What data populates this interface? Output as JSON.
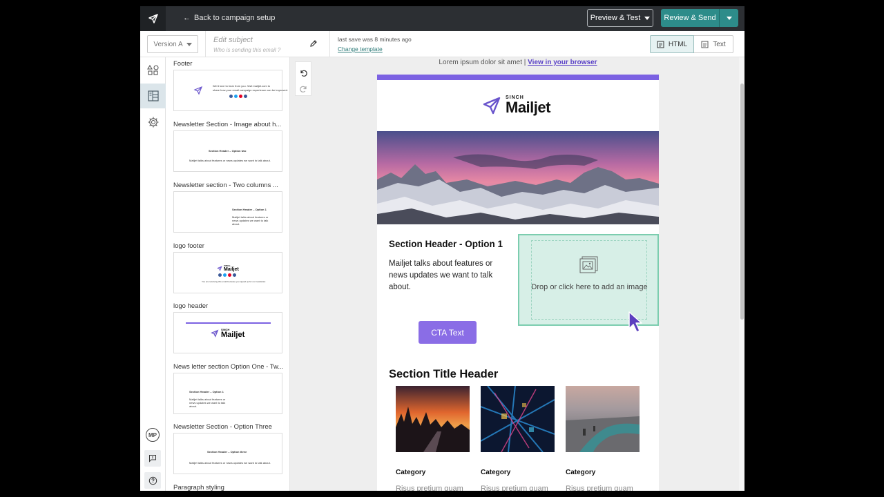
{
  "topbar": {
    "back_label": "Back to campaign setup",
    "preview_label": "Preview & Test",
    "review_label": "Review & Send"
  },
  "subbar": {
    "version": "Version A",
    "subject_placeholder": "Edit subject",
    "sender_placeholder": "Who is sending this email ?",
    "last_save": "last save was 8 minutes ago",
    "change_template": "Change template",
    "html_label": "HTML",
    "text_label": "Text"
  },
  "rail": {
    "user_initials": "MP"
  },
  "templates": [
    {
      "label": "Footer"
    },
    {
      "label": "Newsletter Section - Image about h..."
    },
    {
      "label": "Newsletter section - Two columns ..."
    },
    {
      "label": "logo footer"
    },
    {
      "label": "logo header"
    },
    {
      "label": "News letter section Option One - Tw..."
    },
    {
      "label": "Newsletter Section - Option Three"
    },
    {
      "label": "Paragraph styling"
    }
  ],
  "thumbs": {
    "footer_line1": "We'd love to hear from you. Visit mailjet.com to",
    "footer_line2": "share how your email campaign experience can be improved.",
    "option_two": "Section Header – Option two",
    "talks": "Mailjet talks about features or news updates we want to talk about.",
    "option_one": "Section Header – Option 1",
    "talks_a": "Mailjet talks about features or",
    "talks_b": "news updates we want to talk",
    "talks_c": "about.",
    "option_three": "Section Header – Option three",
    "sinch": "SINCH",
    "mailjet": "Mailjet",
    "logo_footer_text": "You are receiving this email because you signed up for our newsletter."
  },
  "email": {
    "preheader_text": "Lorem ipsum dolor sit amet | ",
    "preheader_link": "View in your browser",
    "brand_sinch": "SINCH",
    "brand_name": "Mailjet",
    "section1_header": "Section Header - Option 1",
    "section1_body": "Mailjet talks about features or news updates we want to talk about.",
    "cta_text": "CTA Text",
    "drop_text": "Drop or click here to add an image",
    "section2_header": "Section Title Header",
    "categories": [
      "Category",
      "Category",
      "Category"
    ],
    "snippets": [
      "Risus pretium quam",
      "Risus pretium quam",
      "Risus pretium quam"
    ]
  },
  "colors": {
    "brand_purple": "#7b61e2",
    "cta": "#8a6de6",
    "accent_teal": "#2d8c8a",
    "drop_zone": "#d7efe7"
  }
}
